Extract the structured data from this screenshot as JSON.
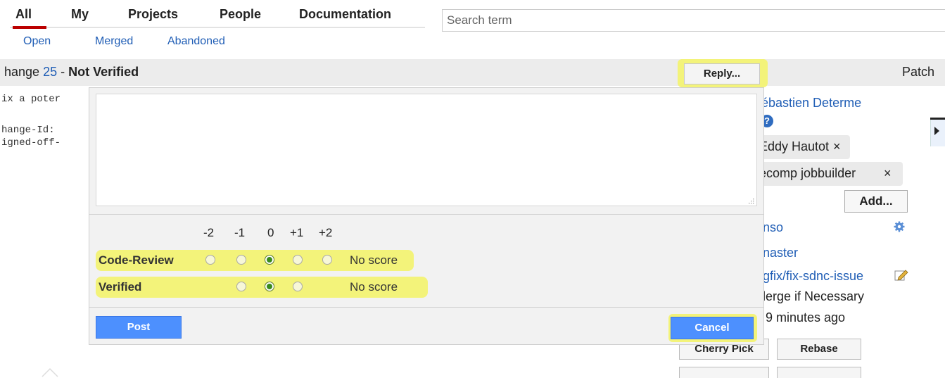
{
  "top_nav": {
    "tabs": [
      {
        "label": "All"
      },
      {
        "label": "My"
      },
      {
        "label": "Projects"
      },
      {
        "label": "People"
      },
      {
        "label": "Documentation"
      }
    ],
    "search_placeholder": "Search term"
  },
  "sub_nav": {
    "items": [
      {
        "label": "Open"
      },
      {
        "label": "Merged"
      },
      {
        "label": "Abandoned"
      }
    ]
  },
  "change_header": {
    "prefix": "hange ",
    "number": "25",
    "separator": " - ",
    "status": "Not Verified",
    "reply_label": "Reply...",
    "patch_label": "Patch"
  },
  "commit_message": {
    "line1": "ix a poter",
    "line2": "hange-Id:",
    "line3": "igned-off-"
  },
  "sidebar": {
    "owner": "ébastien Determe",
    "reviewers": [
      {
        "name": "Eddy Hautot",
        "remove": "×"
      },
      {
        "name": "ecomp jobbuilder",
        "remove": "×"
      }
    ],
    "add_label": "Add...",
    "project": "nso",
    "branch": "naster",
    "topic": "ugfix/fix-sdnc-issue",
    "strategy": "lerge if Necessary",
    "updated": "9 minutes ago",
    "help_glyph": "?",
    "buttons": {
      "cherry_pick": "Cherry Pick",
      "rebase": "Rebase"
    }
  },
  "reply_dialog": {
    "message_value": "",
    "score_headers": [
      "-2",
      "-1",
      "0",
      "+1",
      "+2"
    ],
    "labels": [
      {
        "name": "Code-Review",
        "values": [
          "-2",
          "-1",
          "0",
          "+1",
          "+2"
        ],
        "selected": "0",
        "status": "No score"
      },
      {
        "name": "Verified",
        "values": [
          "-1",
          "0",
          "+1"
        ],
        "selected": "0",
        "status": "No score"
      }
    ],
    "post_label": "Post",
    "cancel_label": "Cancel"
  },
  "colors": {
    "highlight": "#f3f37a",
    "link": "#1f5db5",
    "primary_button": "#4d90fe",
    "active_tab_underline": "#bb0000",
    "radio_selected": "#3a8a1a"
  }
}
